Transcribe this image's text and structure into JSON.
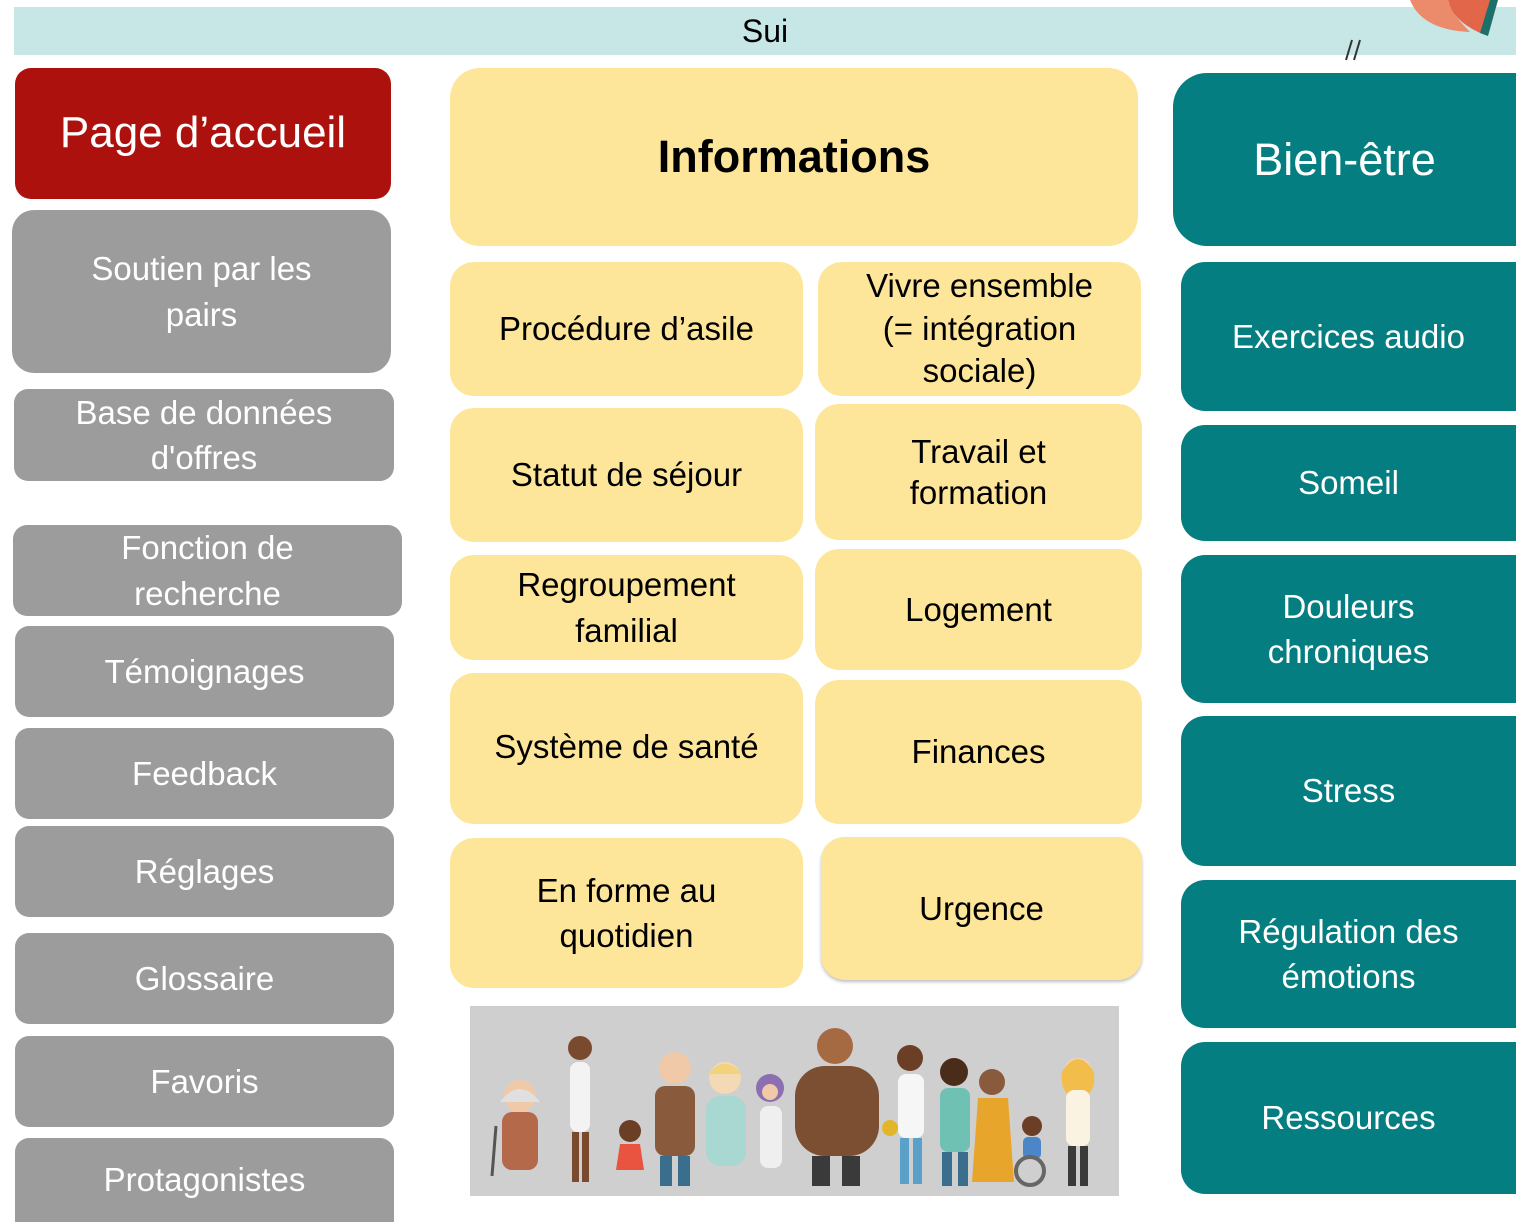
{
  "header": {
    "title": "Sui"
  },
  "nav": {
    "home": "Page d’accueil",
    "items": [
      "Soutien par les pairs",
      "Base de données d'offres",
      "Fonction de recherche",
      "Témoignages",
      "Feedback",
      "Réglages",
      "Glossaire",
      "Favoris",
      "Protagonistes"
    ]
  },
  "info": {
    "title": "Informations",
    "items": [
      "Procédure d’asile",
      "Vivre ensemble (= intégration sociale)",
      "Statut de séjour",
      "Travail et formation",
      "Regroupement familial",
      "Logement",
      "Système de santé",
      "Finances",
      "En forme au quotidien",
      "Urgence"
    ]
  },
  "wellbeing": {
    "title": "Bien-être",
    "items": [
      "Exercices audio",
      "Someil",
      "Douleurs chroniques",
      "Stress",
      "Régulation des émotions",
      "Ressources"
    ]
  },
  "colors": {
    "home": "#ad110d",
    "nav": "#9c9c9c",
    "info": "#fde69a",
    "wellbeing": "#047e80",
    "header": "#c7e6e6"
  }
}
